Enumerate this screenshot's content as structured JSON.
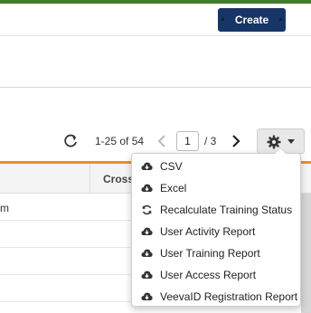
{
  "header": {
    "create_label": "Create"
  },
  "pager": {
    "range_text": "1-25 of 54",
    "current_page": "1",
    "total_text": "/  3"
  },
  "table": {
    "column_header": "Cross",
    "rows": [
      "m",
      "",
      "",
      ""
    ]
  },
  "actions_menu": {
    "items": [
      {
        "label": "CSV",
        "icon": "cloud-download-icon"
      },
      {
        "label": "Excel",
        "icon": "cloud-download-icon"
      },
      {
        "label": "Recalculate Training Status",
        "icon": "refresh-icon"
      },
      {
        "label": "User Activity Report",
        "icon": "cloud-download-icon"
      },
      {
        "label": "User Training Report",
        "icon": "cloud-download-icon"
      },
      {
        "label": "User Access Report",
        "icon": "cloud-download-icon"
      },
      {
        "label": "VeevaID Registration Report",
        "icon": "cloud-download-icon"
      }
    ]
  },
  "colors": {
    "brand_green": "#3f7d2a",
    "create_button": "#173566",
    "accent_orange": "#f08c28"
  }
}
